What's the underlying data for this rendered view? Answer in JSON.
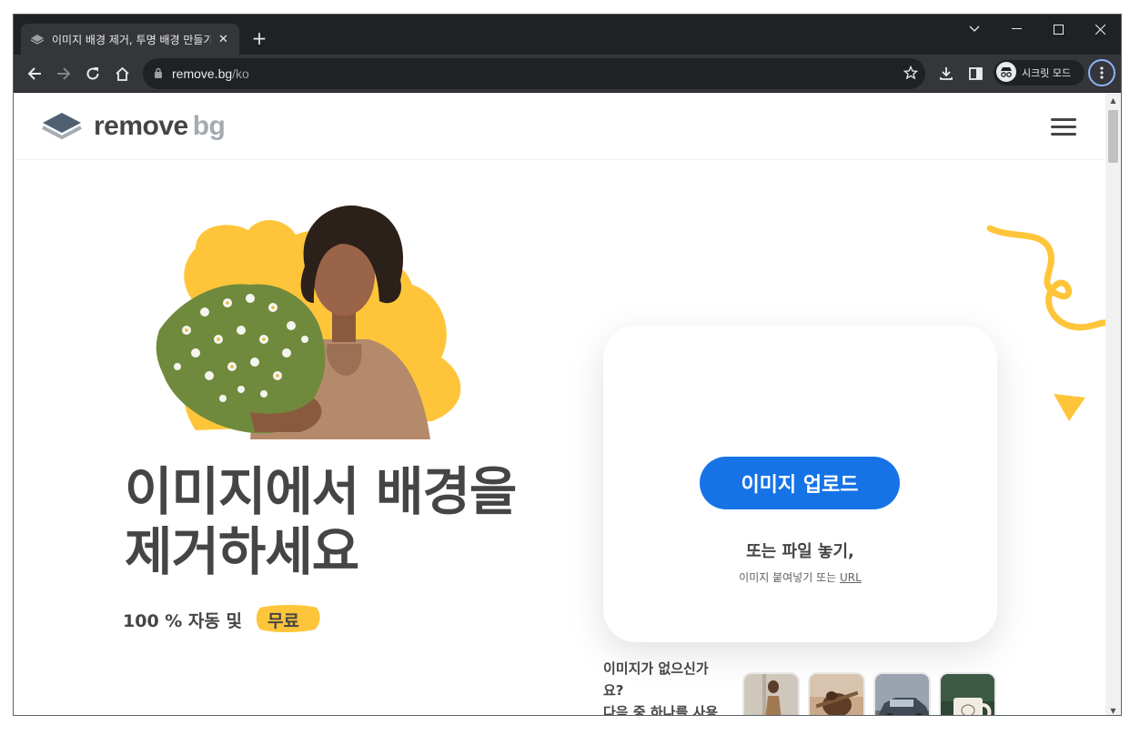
{
  "browser": {
    "tab_title": "이미지 배경 제거, 투명 배경 만들기",
    "tab_close": "✕",
    "new_tab": "+",
    "url_host": "remove.bg",
    "url_path": "/ko",
    "incognito_label": "시크릿 모드"
  },
  "site": {
    "logo_word1": "remove",
    "logo_word2": "bg",
    "accent_color": "#1673e6",
    "yellow_color": "#ffc53a"
  },
  "hero": {
    "headline_line1": "이미지에서 배경을",
    "headline_line2": "제거하세요",
    "sub_prefix": "100 % 자동 및",
    "sub_badge": "무료"
  },
  "upload": {
    "button_label": "이미지 업로드",
    "drop_text": "또는 파일 놓기,",
    "paste_text": "이미지 붙여넣기 또는",
    "url_link": "URL"
  },
  "samples": {
    "prompt_line1": "이미지가 없으신가",
    "prompt_line2": "요?",
    "prompt_line3": "다음 중 하나를 사용"
  }
}
